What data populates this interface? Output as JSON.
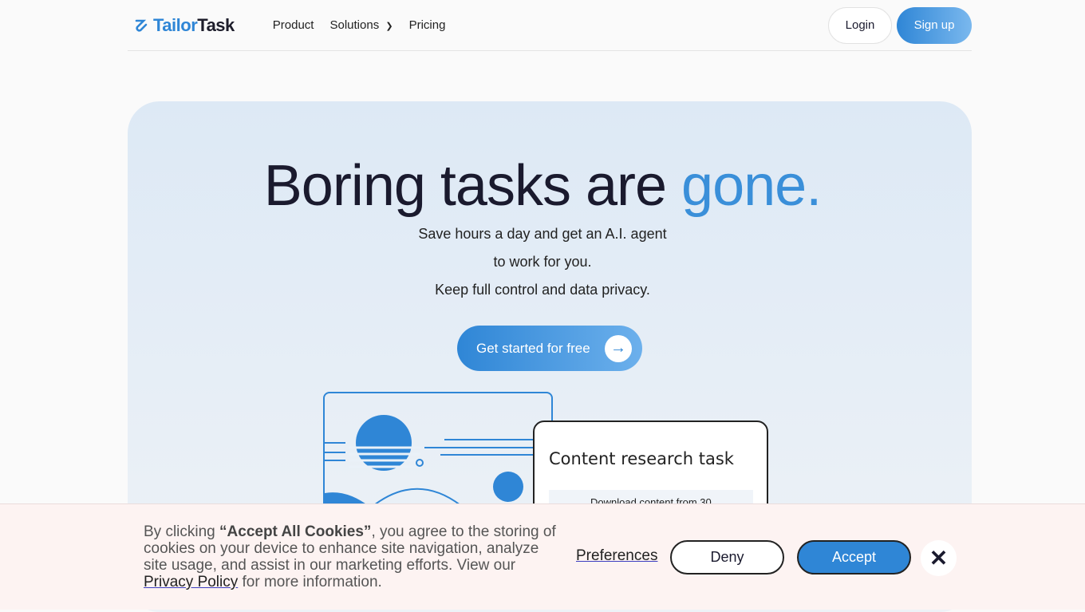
{
  "nav": {
    "logo_a": "Tailor",
    "logo_b": "Task",
    "links": [
      "Product",
      "Solutions",
      "Pricing"
    ],
    "login": "Login",
    "signup": "Sign up"
  },
  "hero": {
    "title_a": "Boring tasks are ",
    "title_b": "gone.",
    "lines": [
      "Save hours a day and get an A.I. agent",
      "to work for you.",
      "Keep full control and data privacy."
    ],
    "cta": "Get started for free",
    "card_title": "Content research task",
    "card_row": "Download content from 30"
  },
  "cookie": {
    "pre": "By clicking ",
    "bold": "“Accept All Cookies”",
    "mid": ", you agree to the storing of cookies on your device to enhance site navigation, analyze site usage, and assist in our marketing efforts. View our ",
    "link": "Privacy Policy",
    "post": " for more information.",
    "preferences": "Preferences",
    "deny": "Deny",
    "accept": "Accept"
  },
  "colors": {
    "accent": "#2f86d6"
  }
}
